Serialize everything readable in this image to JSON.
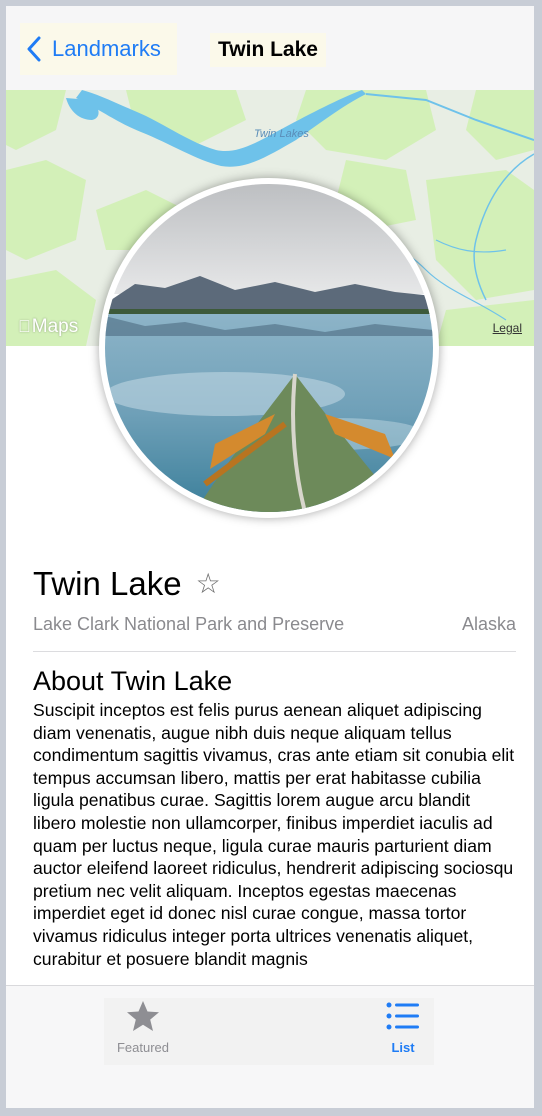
{
  "colors": {
    "accent": "#1f7cf5",
    "secondary_text": "#8a8a8e",
    "water": "#6ec2ea",
    "land": "#d3f0b8"
  },
  "navbar": {
    "back_label": "Landmarks",
    "back_icon": "chevron-left-icon",
    "title": "Twin Lake"
  },
  "map": {
    "lake_label": "Twin Lakes",
    "brand": "Maps",
    "brand_icon": "apple-logo-icon",
    "legal": "Legal"
  },
  "landmark": {
    "name": "Twin Lake",
    "favorite_icon": "star-outline-icon",
    "park": "Lake Clark National Park and Preserve",
    "state": "Alaska",
    "about_title": "About Twin Lake",
    "description": "Suscipit inceptos est felis purus aenean aliquet adipiscing diam venenatis, augue nibh duis neque aliquam tellus condimentum sagittis vivamus, cras ante etiam sit conubia elit tempus accumsan libero, mattis per erat habitasse cubilia ligula penatibus curae. Sagittis lorem augue arcu blandit libero molestie non ullamcorper, finibus imperdiet iaculis ad quam per luctus neque, ligula curae mauris parturient diam auctor eleifend laoreet ridiculus, hendrerit adipiscing sociosqu pretium nec velit aliquam. Inceptos egestas maecenas imperdiet eget id donec nisl curae congue, massa tortor vivamus ridiculus integer porta ultrices venenatis aliquet, curabitur et posuere blandit magnis"
  },
  "tabbar": {
    "tabs": [
      {
        "label": "Featured",
        "icon": "star-filled-icon",
        "selected": false
      },
      {
        "label": "List",
        "icon": "list-icon",
        "selected": true
      }
    ]
  }
}
